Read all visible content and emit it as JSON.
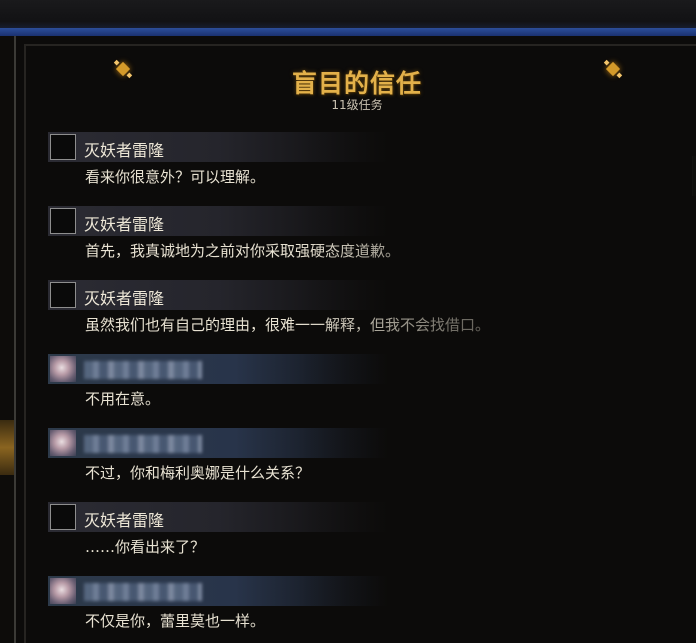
{
  "quest": {
    "title": "盲目的信任",
    "level": "11级任务"
  },
  "colors": {
    "title_gold": "#e3b14a",
    "frame_blue": "#2c4e9a",
    "text": "#e8e2d2"
  },
  "dialogue": [
    {
      "speaker": "灭妖者雷隆",
      "speaker_type": "npc",
      "text": "看来你很意外？可以理解。"
    },
    {
      "speaker": "灭妖者雷隆",
      "speaker_type": "npc",
      "text": "首先，我真诚地为之前对你采取强硬态度道歉。"
    },
    {
      "speaker": "灭妖者雷隆",
      "speaker_type": "npc",
      "text": "虽然我们也有自己的理由，很难一一解释，但我不会找借口。"
    },
    {
      "speaker": "",
      "speaker_type": "player",
      "text": "不用在意。"
    },
    {
      "speaker": "",
      "speaker_type": "player",
      "text": "不过，你和梅利奥娜是什么关系？"
    },
    {
      "speaker": "灭妖者雷隆",
      "speaker_type": "npc",
      "text": "……你看出来了？"
    },
    {
      "speaker": "",
      "speaker_type": "player",
      "text": "不仅是你，蕾里莫也一样。"
    }
  ]
}
